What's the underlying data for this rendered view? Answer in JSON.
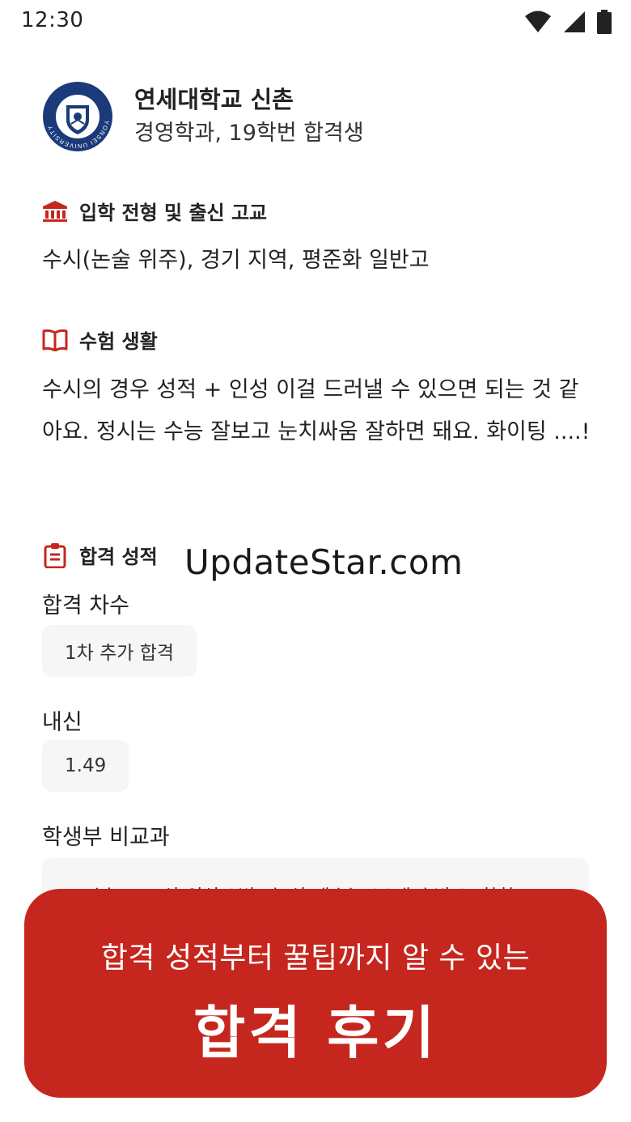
{
  "status_bar": {
    "time": "12:30",
    "icons": [
      "wifi-icon",
      "signal-icon",
      "battery-icon"
    ]
  },
  "header": {
    "logo": "yonsei-university-seal",
    "logo_ring_text": "YONSEI UNIVERSITY",
    "university": "연세대학교 신촌",
    "subtitle": "경영학과, 19학번 합격생"
  },
  "sections": {
    "admission": {
      "icon": "building-icon",
      "title": "입학 전형 및 출신 고교",
      "text": "수시(논술 위주), 경기 지역, 평준화 일반고"
    },
    "exam_life": {
      "icon": "book-icon",
      "title": "수험 생활",
      "text": "수시의 경우 성적 + 인성 이걸 드러낼 수 있으면 되는 것 같아요. 정시는 수능 잘보고 눈치싸움 잘하면 돼요. 화이팅 ....!"
    },
    "scores": {
      "icon": "clipboard-icon",
      "title": "합격 성적",
      "round_label": "합격 차수",
      "round_value": "1차 추가 합격",
      "gpa_label": "내신",
      "gpa_value": "1.49",
      "extracurricular_label": "학생부 비교과",
      "extracurricular_value": "1. 수능모 교상 외상 3번, 초 상 개수는 20개 초반 2. 학학"
    }
  },
  "watermark": "UpdateStar.com",
  "banner": {
    "subtitle": "합격 성적부터 꿀팁까지 알 수 있는",
    "title": "합격 후기"
  },
  "colors": {
    "accent": "#c5271e",
    "logo_navy": "#1b3a7a",
    "chip_bg": "#f6f6f6"
  }
}
